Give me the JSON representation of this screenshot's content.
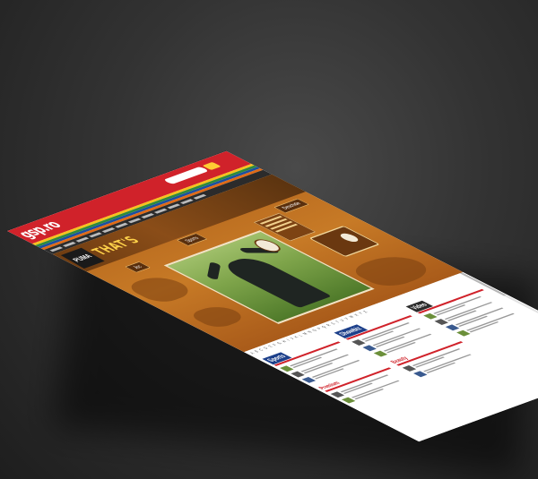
{
  "header": {
    "logo": "gsp.ro"
  },
  "hero": {
    "brand": "PUMA",
    "headline": "THAT'S",
    "tabs": [
      "Joc",
      "Sports",
      "Deschide"
    ]
  },
  "content": {
    "columns": [
      {
        "title": "Sports"
      },
      {
        "title": "Showbiz"
      },
      {
        "title": "Video"
      }
    ],
    "sections": [
      "Premium",
      "Beauty"
    ]
  },
  "colors": {
    "brand_red": "#d0222a",
    "hero_brown": "#c77a26",
    "accent_yellow": "#ffd24a"
  }
}
